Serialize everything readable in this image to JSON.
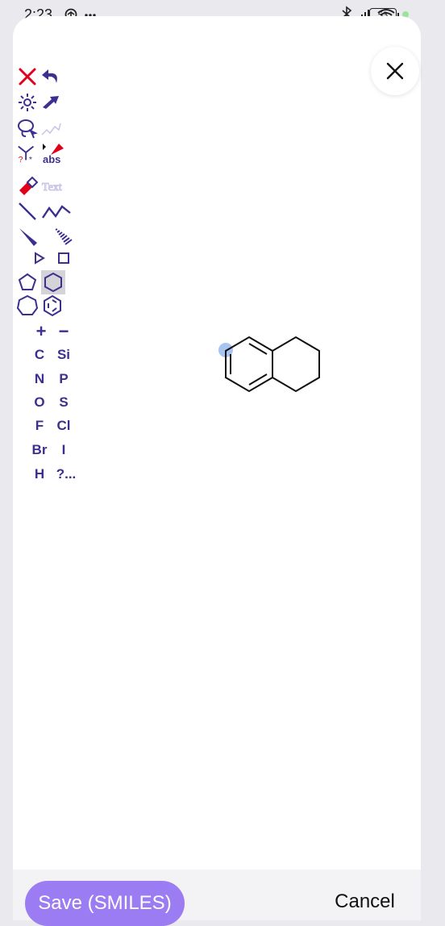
{
  "status_bar": {
    "time": "2:23",
    "battery": "53",
    "icons": [
      "data-saver-icon",
      "more-icon",
      "bluetooth-icon",
      "signal-icon",
      "wifi-icon",
      "battery-icon"
    ]
  },
  "toolbar": {
    "plus_label": "+",
    "minus_label": "−",
    "elements": [
      "C",
      "Si",
      "N",
      "P",
      "O",
      "S",
      "F",
      "Cl",
      "Br",
      "I",
      "H",
      "?..."
    ],
    "abs_label": "abs",
    "text_label": "Text"
  },
  "actions": {
    "save_label": "Save (SMILES)",
    "cancel_label": "Cancel"
  },
  "colors": {
    "accent": "#9b7cf2",
    "tool_purple": "#3b2f8f",
    "tool_red": "#e0001a",
    "highlight": "#a8c4f0"
  }
}
